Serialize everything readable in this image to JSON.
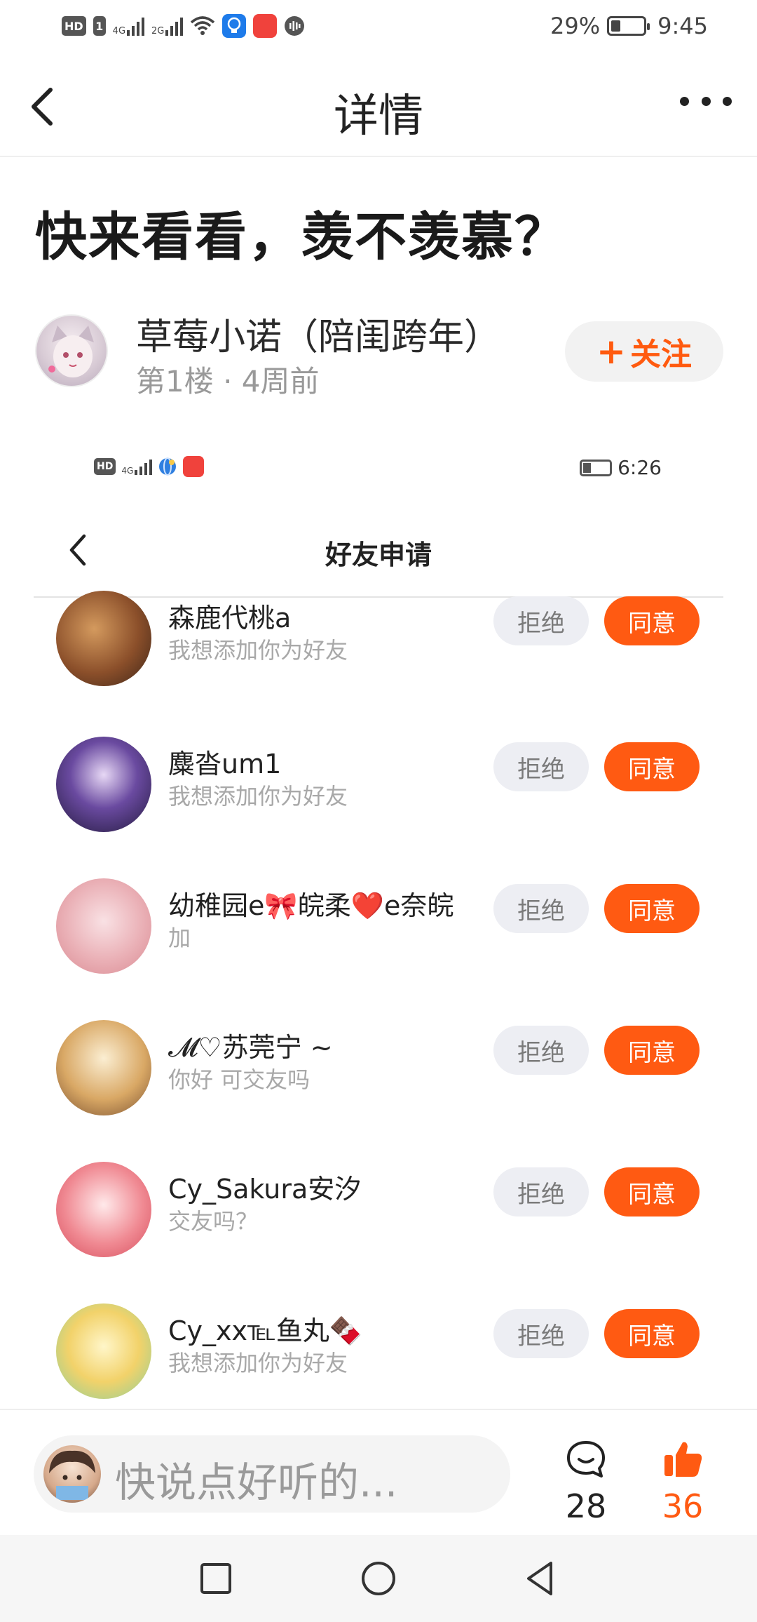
{
  "status_bar": {
    "hd": "HD",
    "sim1": "1",
    "net1": "4G",
    "net2": "2G",
    "battery_percent": "29%",
    "time": "9:45",
    "battery_level": 0.29
  },
  "nav": {
    "title": "详情"
  },
  "post": {
    "title": "快来看看，羡不羡慕？",
    "author_name": "草莓小诺（陪闺跨年）",
    "author_meta": "第1楼 · 4周前",
    "follow_label": "关注",
    "follow_plus": "+"
  },
  "embedded": {
    "status": {
      "hd": "HD",
      "net": "4G",
      "time": "6:26",
      "battery_level": 0.3
    },
    "title": "好友申请",
    "reject_label": "拒绝",
    "accept_label": "同意",
    "requests": [
      {
        "name": "森鹿代桃a",
        "message": "我想添加你为好友"
      },
      {
        "name": "麋沓um1",
        "message": "我想添加你为好友"
      },
      {
        "name": "幼稚园e🎀皖柔❤️e奈皖",
        "message": "加"
      },
      {
        "name": "𝓜♡苏莞宁 ~",
        "message": "你好 可交友吗"
      },
      {
        "name": "Cy_Sakura安汐",
        "message": "交友吗？"
      },
      {
        "name": "Cy_xx℡鱼丸🍫",
        "message": "我想添加你为好友"
      }
    ]
  },
  "bottom": {
    "placeholder": "快说点好听的...",
    "comment_count": "28",
    "like_count": "36"
  },
  "colors": {
    "accent": "#ff5a12",
    "follow_bg": "#f2f2f2",
    "reject_bg": "#edeef3"
  }
}
